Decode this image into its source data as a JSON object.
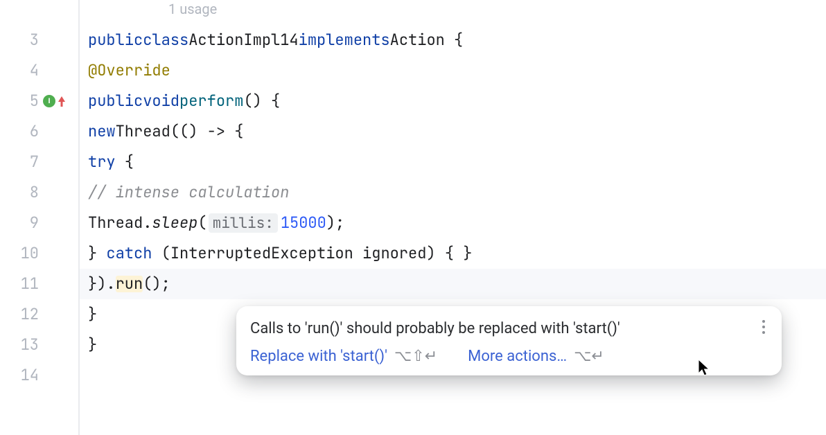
{
  "lens": {
    "usage": "1 usage"
  },
  "gutter": {
    "lines": [
      "3",
      "4",
      "5",
      "6",
      "7",
      "8",
      "9",
      "10",
      "11",
      "12",
      "13",
      "14"
    ]
  },
  "code": {
    "l3": {
      "kw_public": "public",
      "kw_class": "class",
      "name": "ActionImpl14",
      "kw_impl": "implements",
      "iface": "Action",
      "brace": " {"
    },
    "l4": {
      "ann": "@Override"
    },
    "l5": {
      "kw_public": "public",
      "kw_void": "void",
      "name": "perform",
      "rest": "() {"
    },
    "l6": {
      "kw_new": "new",
      "type": "Thread",
      "rest": "(() -> {"
    },
    "l7": {
      "kw_try": "try",
      "brace": " {"
    },
    "l8": {
      "comment": "// intense calculation"
    },
    "l9": {
      "cls": "Thread",
      "dot": ".",
      "method": "sleep",
      "open": "(",
      "hint": "millis:",
      "num": "15000",
      "close": ");"
    },
    "l10": {
      "close_try": "} ",
      "kw_catch": "catch",
      "open": " (",
      "exc": "InterruptedException",
      "sp": " ",
      "var": "ignored",
      "rest": ") { }"
    },
    "l11": {
      "prefix": "}).",
      "call": "run",
      "suffix": "();"
    },
    "l12": {
      "brace": "}"
    },
    "l13": {
      "brace": "}"
    }
  },
  "popup": {
    "message": "Calls to 'run()' should probably be replaced with 'start()'",
    "action_primary": {
      "label": "Replace with 'start()'",
      "shortcut": "⌥⇧↵"
    },
    "action_more": {
      "label": "More actions…",
      "shortcut": "⌥↵"
    }
  }
}
